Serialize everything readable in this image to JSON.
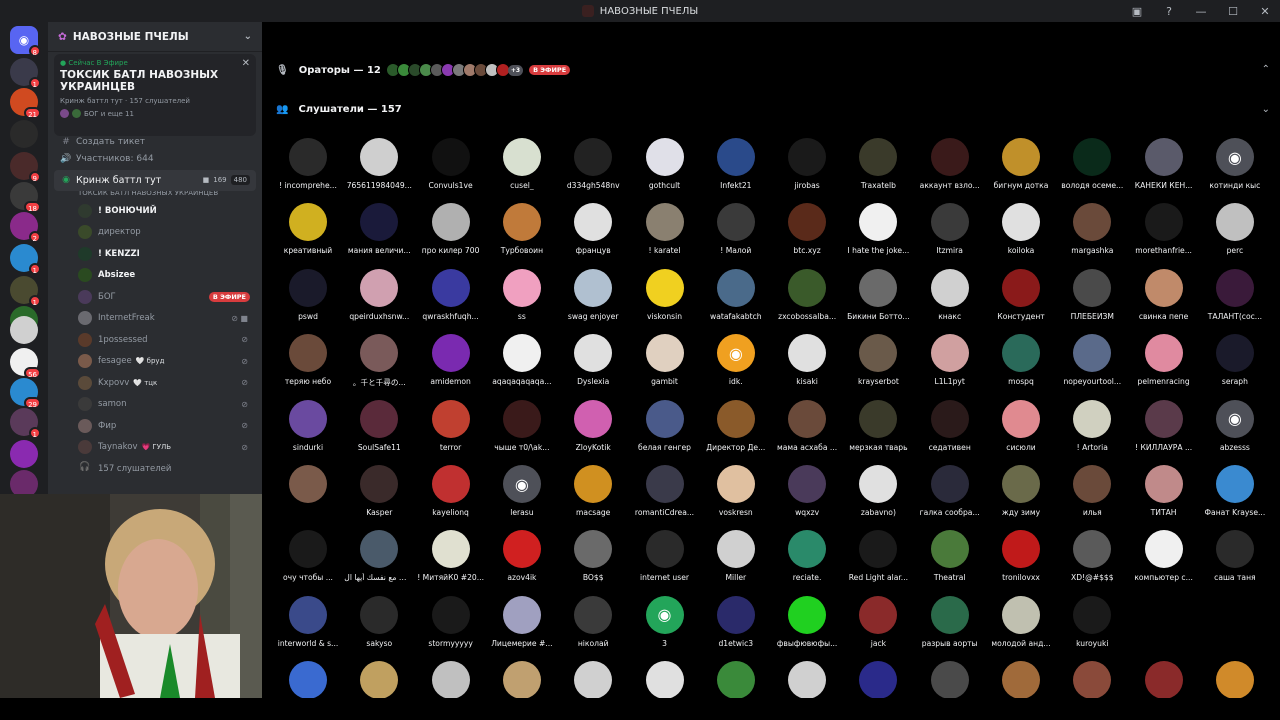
{
  "window_title": "НАВОЗНЫЕ ПЧЕЛЫ",
  "server": {
    "name": "НАВОЗНЫЕ ПЧЕЛЫ"
  },
  "guild_badges": [
    "8",
    "1",
    "21",
    "9",
    "18",
    "2",
    "1",
    "1",
    "56",
    "29",
    "1"
  ],
  "stage": {
    "live_label": "Сейчас В Эфире",
    "title": "ТОКСИК БАТЛ НАВОЗНЫХ УКРАИНЦЕВ",
    "meta": "Кринж баттл тут · 157 слушателей",
    "hosts": "БОГ и еще 11"
  },
  "channels": {
    "create_ticket": "Создать тикет",
    "participants": "Участников: 644",
    "voice_channel": {
      "name": "Кринж баттл тут",
      "cam_count": "169",
      "count2": "480",
      "topic": "ТОКСИК БАТЛ НАВОЗНЫХ УКРАИНЦЕВ"
    },
    "users": [
      {
        "name": "! ВОНЮЧИЙ",
        "tag": "",
        "bold": true,
        "color": "#2f3a2f"
      },
      {
        "name": "директор",
        "tag": "",
        "bold": false,
        "color": "#3a4a2a"
      },
      {
        "name": "! KENZZI",
        "tag": "",
        "bold": true,
        "color": "#1f3a2a"
      },
      {
        "name": "Absizee",
        "tag": "",
        "bold": true,
        "color": "#2a4a20"
      },
      {
        "name": "БОГ",
        "tag": "",
        "bold": false,
        "color": "#4a3a5a",
        "onair": "В ЭФИРЕ"
      },
      {
        "name": "InternetFreak",
        "tag": "",
        "bold": false,
        "color": "#6a6a70"
      },
      {
        "name": "1possessed",
        "tag": "",
        "bold": false,
        "color": "#5a3a2a"
      },
      {
        "name": "fesagee",
        "tag": "🤍 бруд",
        "bold": false,
        "color": "#7a5a4a"
      },
      {
        "name": "Kxpovv",
        "tag": "🤍 тцк",
        "bold": false,
        "color": "#5a4a3a"
      },
      {
        "name": "samon",
        "tag": "",
        "bold": false,
        "color": "#3a3a3a"
      },
      {
        "name": "Фир",
        "tag": "",
        "bold": false,
        "color": "#6a5a5a"
      },
      {
        "name": "Taynakov",
        "tag": "💗 ГУЛЬ",
        "bold": false,
        "color": "#4a3a3a"
      }
    ],
    "listeners_count": "157 слушателей"
  },
  "speakers": {
    "label": "Ораторы — 12",
    "extra": "+3",
    "onair": "В ЭФИРЕ"
  },
  "listeners": {
    "label": "Слушатели — 157",
    "items": [
      {
        "name": "! incomprehe...",
        "color": "#2a2a2a"
      },
      {
        "name": "765611984049...",
        "color": "#cfcfcf"
      },
      {
        "name": "Convuls1ve",
        "color": "#111111"
      },
      {
        "name": "cusel_",
        "color": "#d8e0d0"
      },
      {
        "name": "d334gh548nv",
        "color": "#222222"
      },
      {
        "name": "gothcult",
        "color": "#e0e0e8"
      },
      {
        "name": "Infekt21",
        "color": "#2a4a8a"
      },
      {
        "name": "jirobas",
        "color": "#1a1a1a"
      },
      {
        "name": "Traxatelb",
        "color": "#3a3a2a"
      },
      {
        "name": "аккаунт взло...",
        "color": "#3a1a1a"
      },
      {
        "name": "бигнум дотка",
        "color": "#c0902a"
      },
      {
        "name": "володя осеме...",
        "color": "#0a2a1a"
      },
      {
        "name": "КАНЕКИ КЕН...",
        "color": "#5a5a6a"
      },
      {
        "name": "котинди кыс",
        "color": "#4e5058",
        "discord": true
      },
      {
        "name": "креативный",
        "color": "#d0b020"
      },
      {
        "name": "мания величи...",
        "color": "#1a1a3a"
      },
      {
        "name": "про килер 700",
        "color": "#b0b0b0"
      },
      {
        "name": "Турбовоин",
        "color": "#c07a3a"
      },
      {
        "name": "францув",
        "color": "#e0e0e0"
      },
      {
        "name": "! karatel",
        "color": "#8a8070"
      },
      {
        "name": "! Малой",
        "color": "#3a3a3a"
      },
      {
        "name": "btc.xyz",
        "color": "#5a2a1a"
      },
      {
        "name": "I hate the joke...",
        "color": "#f0f0f0"
      },
      {
        "name": "Itzmira",
        "color": "#3a3a3a"
      },
      {
        "name": "koiloka",
        "color": "#e0e0e0"
      },
      {
        "name": "margashka",
        "color": "#6a4a3a"
      },
      {
        "name": "morethanfrie...",
        "color": "#1a1a1a"
      },
      {
        "name": "perc",
        "color": "#c0c0c0"
      },
      {
        "name": "pswd",
        "color": "#1a1a2a"
      },
      {
        "name": "qpeirduxhsnw...",
        "color": "#d0a0b0"
      },
      {
        "name": "qwraskhfuqh...",
        "color": "#3a3aa0"
      },
      {
        "name": "ss",
        "color": "#f0a0c0"
      },
      {
        "name": "swag enjoyer",
        "color": "#b0c0d0"
      },
      {
        "name": "viskonsin",
        "color": "#f0d020"
      },
      {
        "name": "watafakabtch",
        "color": "#4a6a8a"
      },
      {
        "name": "zxcobossalba...",
        "color": "#3a5a2a"
      },
      {
        "name": "Бикини Ботто...",
        "color": "#6a6a6a"
      },
      {
        "name": "кнакс",
        "color": "#d0d0d0"
      },
      {
        "name": "Констудент",
        "color": "#8a1a1a"
      },
      {
        "name": "ПЛЕБЕИЗМ",
        "color": "#4a4a4a"
      },
      {
        "name": "свинка пепе",
        "color": "#c08a6a"
      },
      {
        "name": "ТАЛАНТ(сос...",
        "color": "#3a1a3a"
      },
      {
        "name": "теряю небо",
        "color": "#6a4a3a"
      },
      {
        "name": "。千と千尋の...",
        "color": "#7a5a5a"
      },
      {
        "name": "amidemon",
        "color": "#7a2ab0"
      },
      {
        "name": "aqaqaqaqaqa...",
        "color": "#f0f0f0"
      },
      {
        "name": "Dyslexia",
        "color": "#e0e0e0"
      },
      {
        "name": "gambit",
        "color": "#e0d0c0"
      },
      {
        "name": "idk.",
        "color": "#f0a020",
        "discord": true
      },
      {
        "name": "kisaki",
        "color": "#e0e0e0"
      },
      {
        "name": "krayserbot",
        "color": "#6a5a4a"
      },
      {
        "name": "L1L1pyt",
        "color": "#d0a0a0"
      },
      {
        "name": "mospq",
        "color": "#2a6a5a"
      },
      {
        "name": "nopeyourtool...",
        "color": "#5a6a8a"
      },
      {
        "name": "pelmenracing",
        "color": "#e08aa0"
      },
      {
        "name": "seraph",
        "color": "#1a1a2a"
      },
      {
        "name": "sindurki",
        "color": "#6a4aa0"
      },
      {
        "name": "SoulSafe11",
        "color": "#5a2a3a"
      },
      {
        "name": "terror",
        "color": "#c04030"
      },
      {
        "name": "чыше т0/\\ak...",
        "color": "#3a1a1a"
      },
      {
        "name": "ZloyKotik",
        "color": "#d060b0"
      },
      {
        "name": "белая генгер",
        "color": "#4a5a8a"
      },
      {
        "name": "Директор Де...",
        "color": "#8a5a2a"
      },
      {
        "name": "мама асхаба ...",
        "color": "#6a4a3a"
      },
      {
        "name": "мерзкая тварь",
        "color": "#3a3a2a"
      },
      {
        "name": "седативен",
        "color": "#2a1a1a"
      },
      {
        "name": "сисюли",
        "color": "#e08a90"
      },
      {
        "name": "! Artoria",
        "color": "#d0d0c0"
      },
      {
        "name": "! КИЛЛАУРА ...",
        "color": "#5a3a4a"
      },
      {
        "name": "abzesss",
        "color": "#4e5058",
        "discord": true
      },
      {
        "name": "",
        "color": "#7a5a4a"
      },
      {
        "name": "Kasper",
        "color": "#3a2a2a"
      },
      {
        "name": "kayelionq",
        "color": "#c03030"
      },
      {
        "name": "lerasu",
        "color": "#4e5058",
        "discord": true
      },
      {
        "name": "macsage",
        "color": "#d09020"
      },
      {
        "name": "romantiCdrea...",
        "color": "#3a3a4a"
      },
      {
        "name": "voskresn",
        "color": "#e0c0a0"
      },
      {
        "name": "wqxzv",
        "color": "#4a3a5a"
      },
      {
        "name": "zabavno)",
        "color": "#e0e0e0"
      },
      {
        "name": "галка сообра...",
        "color": "#2a2a3a"
      },
      {
        "name": "жду зиму",
        "color": "#6a6a4a"
      },
      {
        "name": "илья",
        "color": "#6a4a3a"
      },
      {
        "name": "ТИТАН",
        "color": "#c08a8a"
      },
      {
        "name": "Фанат Krayse...",
        "color": "#3a8ad0"
      },
      {
        "name": "очу чтобы ...",
        "color": "#1a1a1a"
      },
      {
        "name": "س مع نفسك أيها ال...",
        "color": "#4a5a6a"
      },
      {
        "name": "! MитяйК0 #20...",
        "color": "#e0e0d0"
      },
      {
        "name": "azov4ik",
        "color": "#d02020"
      },
      {
        "name": "BO$$",
        "color": "#6a6a6a"
      },
      {
        "name": "internet user",
        "color": "#2a2a2a"
      },
      {
        "name": "Miller",
        "color": "#d0d0d0"
      },
      {
        "name": "reciate.",
        "color": "#2a8a6a"
      },
      {
        "name": "Red Light alar...",
        "color": "#1a1a1a"
      },
      {
        "name": "Theatral",
        "color": "#4a7a3a"
      },
      {
        "name": "tronilovxx",
        "color": "#c01a1a"
      },
      {
        "name": "XD!@#$$$",
        "color": "#5a5a5a"
      },
      {
        "name": "компьютер с...",
        "color": "#f0f0f0"
      },
      {
        "name": "саша таня",
        "color": "#2a2a2a"
      },
      {
        "name": "interworld & s...",
        "color": "#3a4a8a"
      },
      {
        "name": "sakyso",
        "color": "#2a2a2a"
      },
      {
        "name": "stormyyyyy",
        "color": "#1a1a1a"
      },
      {
        "name": "Лицемерие #...",
        "color": "#a0a0c0"
      },
      {
        "name": "нiколай",
        "color": "#3a3a3a"
      },
      {
        "name": "3",
        "color": "#23a55a",
        "discord": true
      },
      {
        "name": "d1etwic3",
        "color": "#2a2a6a"
      },
      {
        "name": "фвыфювюфы...",
        "color": "#20d020"
      },
      {
        "name": "jack",
        "color": "#8a2a2a"
      },
      {
        "name": "разрыв аорты",
        "color": "#2a6a4a"
      },
      {
        "name": "молодой анд...",
        "color": "#c0c0b0"
      },
      {
        "name": "kuroyuki",
        "color": "#1a1a1a"
      }
    ]
  }
}
